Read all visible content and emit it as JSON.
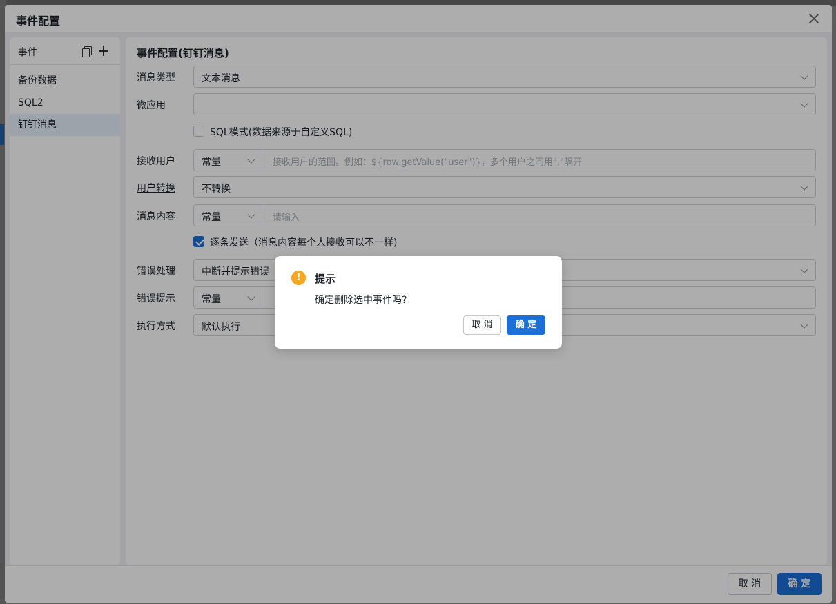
{
  "dialog": {
    "title": "事件配置",
    "footer": {
      "cancel": "取 消",
      "ok": "确 定"
    }
  },
  "events_panel": {
    "header": "事件",
    "items": [
      {
        "label": "备份数据",
        "active": false
      },
      {
        "label": "SQL2",
        "active": false
      },
      {
        "label": "钉钉消息",
        "active": true
      }
    ]
  },
  "form": {
    "title": "事件配置(钉钉消息)",
    "message_type": {
      "label": "消息类型",
      "value": "文本消息"
    },
    "micro_app": {
      "label": "微应用",
      "value": ""
    },
    "sql_mode": {
      "label": "SQL模式(数据来源于自定义SQL)",
      "checked": false
    },
    "receiver": {
      "label": "接收用户",
      "mode": "常量",
      "placeholder": "接收用户的范围。例如：${row.getValue(\"user\")}，多个用户之间用\",\"隔开"
    },
    "user_convert": {
      "label": "用户转换",
      "value": "不转换"
    },
    "content": {
      "label": "消息内容",
      "mode": "常量",
      "placeholder": "请输入"
    },
    "send_each": {
      "label": "逐条发送（消息内容每个人接收可以不一样)",
      "checked": true
    },
    "error_handling": {
      "label": "错误处理",
      "value": "中断并提示错误"
    },
    "error_tip": {
      "label": "错误提示",
      "mode": "常量"
    },
    "exec_mode": {
      "label": "执行方式",
      "value": "默认执行"
    }
  },
  "confirm_popup": {
    "title": "提示",
    "message": "确定删除选中事件吗?",
    "cancel": "取 消",
    "ok": "确 定"
  },
  "colors": {
    "primary": "#1d6fd8",
    "warning": "#f5a623",
    "active_item": "#e6f0fb"
  }
}
